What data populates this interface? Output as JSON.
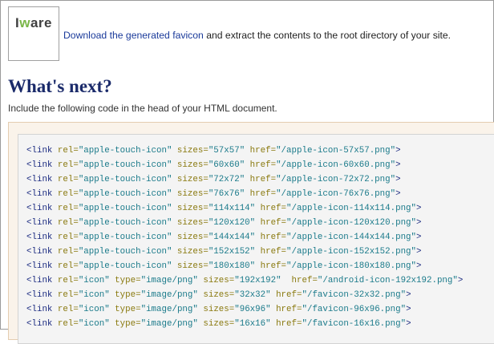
{
  "logo": {
    "text_main": "I",
    "text_accent": "w",
    "text_rest": "are"
  },
  "intro": {
    "link_text": "Download the generated favicon",
    "rest_text": " and extract the contents to the root directory of your site."
  },
  "heading": "What's next?",
  "subtext": "Include the following code in the head of your HTML document.",
  "code_lines": [
    [
      [
        "tag",
        "<link "
      ],
      [
        "attr",
        "rel="
      ],
      [
        "val",
        "\"apple-touch-icon\""
      ],
      [
        "attr",
        " sizes="
      ],
      [
        "val",
        "\"57x57\""
      ],
      [
        "attr",
        " href="
      ],
      [
        "val",
        "\"/apple-icon-57x57.png\""
      ],
      [
        "tag",
        ">"
      ]
    ],
    [
      [
        "tag",
        "<link "
      ],
      [
        "attr",
        "rel="
      ],
      [
        "val",
        "\"apple-touch-icon\""
      ],
      [
        "attr",
        " sizes="
      ],
      [
        "val",
        "\"60x60\""
      ],
      [
        "attr",
        " href="
      ],
      [
        "val",
        "\"/apple-icon-60x60.png\""
      ],
      [
        "tag",
        ">"
      ]
    ],
    [
      [
        "tag",
        "<link "
      ],
      [
        "attr",
        "rel="
      ],
      [
        "val",
        "\"apple-touch-icon\""
      ],
      [
        "attr",
        " sizes="
      ],
      [
        "val",
        "\"72x72\""
      ],
      [
        "attr",
        " href="
      ],
      [
        "val",
        "\"/apple-icon-72x72.png\""
      ],
      [
        "tag",
        ">"
      ]
    ],
    [
      [
        "tag",
        "<link "
      ],
      [
        "attr",
        "rel="
      ],
      [
        "val",
        "\"apple-touch-icon\""
      ],
      [
        "attr",
        " sizes="
      ],
      [
        "val",
        "\"76x76\""
      ],
      [
        "attr",
        " href="
      ],
      [
        "val",
        "\"/apple-icon-76x76.png\""
      ],
      [
        "tag",
        ">"
      ]
    ],
    [
      [
        "tag",
        "<link "
      ],
      [
        "attr",
        "rel="
      ],
      [
        "val",
        "\"apple-touch-icon\""
      ],
      [
        "attr",
        " sizes="
      ],
      [
        "val",
        "\"114x114\""
      ],
      [
        "attr",
        " href="
      ],
      [
        "val",
        "\"/apple-icon-114x114.png\""
      ],
      [
        "tag",
        ">"
      ]
    ],
    [
      [
        "tag",
        "<link "
      ],
      [
        "attr",
        "rel="
      ],
      [
        "val",
        "\"apple-touch-icon\""
      ],
      [
        "attr",
        " sizes="
      ],
      [
        "val",
        "\"120x120\""
      ],
      [
        "attr",
        " href="
      ],
      [
        "val",
        "\"/apple-icon-120x120.png\""
      ],
      [
        "tag",
        ">"
      ]
    ],
    [
      [
        "tag",
        "<link "
      ],
      [
        "attr",
        "rel="
      ],
      [
        "val",
        "\"apple-touch-icon\""
      ],
      [
        "attr",
        " sizes="
      ],
      [
        "val",
        "\"144x144\""
      ],
      [
        "attr",
        " href="
      ],
      [
        "val",
        "\"/apple-icon-144x144.png\""
      ],
      [
        "tag",
        ">"
      ]
    ],
    [
      [
        "tag",
        "<link "
      ],
      [
        "attr",
        "rel="
      ],
      [
        "val",
        "\"apple-touch-icon\""
      ],
      [
        "attr",
        " sizes="
      ],
      [
        "val",
        "\"152x152\""
      ],
      [
        "attr",
        " href="
      ],
      [
        "val",
        "\"/apple-icon-152x152.png\""
      ],
      [
        "tag",
        ">"
      ]
    ],
    [
      [
        "tag",
        "<link "
      ],
      [
        "attr",
        "rel="
      ],
      [
        "val",
        "\"apple-touch-icon\""
      ],
      [
        "attr",
        " sizes="
      ],
      [
        "val",
        "\"180x180\""
      ],
      [
        "attr",
        " href="
      ],
      [
        "val",
        "\"/apple-icon-180x180.png\""
      ],
      [
        "tag",
        ">"
      ]
    ],
    [
      [
        "tag",
        "<link "
      ],
      [
        "attr",
        "rel="
      ],
      [
        "val",
        "\"icon\""
      ],
      [
        "attr",
        " type="
      ],
      [
        "val",
        "\"image/png\""
      ],
      [
        "attr",
        " sizes="
      ],
      [
        "val",
        "\"192x192\""
      ],
      [
        "attr",
        "  href="
      ],
      [
        "val",
        "\"/android-icon-192x192.png\""
      ],
      [
        "tag",
        ">"
      ]
    ],
    [
      [
        "tag",
        "<link "
      ],
      [
        "attr",
        "rel="
      ],
      [
        "val",
        "\"icon\""
      ],
      [
        "attr",
        " type="
      ],
      [
        "val",
        "\"image/png\""
      ],
      [
        "attr",
        " sizes="
      ],
      [
        "val",
        "\"32x32\""
      ],
      [
        "attr",
        " href="
      ],
      [
        "val",
        "\"/favicon-32x32.png\""
      ],
      [
        "tag",
        ">"
      ]
    ],
    [
      [
        "tag",
        "<link "
      ],
      [
        "attr",
        "rel="
      ],
      [
        "val",
        "\"icon\""
      ],
      [
        "attr",
        " type="
      ],
      [
        "val",
        "\"image/png\""
      ],
      [
        "attr",
        " sizes="
      ],
      [
        "val",
        "\"96x96\""
      ],
      [
        "attr",
        " href="
      ],
      [
        "val",
        "\"/favicon-96x96.png\""
      ],
      [
        "tag",
        ">"
      ]
    ],
    [
      [
        "tag",
        "<link "
      ],
      [
        "attr",
        "rel="
      ],
      [
        "val",
        "\"icon\""
      ],
      [
        "attr",
        " type="
      ],
      [
        "val",
        "\"image/png\""
      ],
      [
        "attr",
        " sizes="
      ],
      [
        "val",
        "\"16x16\""
      ],
      [
        "attr",
        " href="
      ],
      [
        "val",
        "\"/favicon-16x16.png\""
      ],
      [
        "tag",
        ">"
      ]
    ]
  ]
}
